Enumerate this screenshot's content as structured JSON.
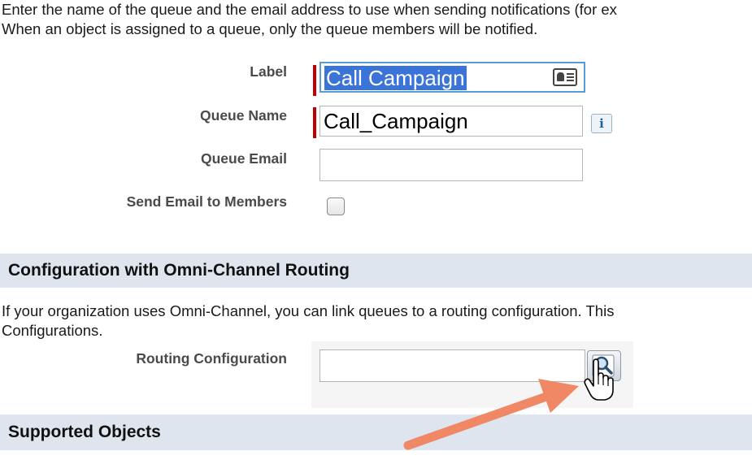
{
  "intro": {
    "line1": "Enter the name of the queue and the email address to use when sending notifications (for ex",
    "line2": "When an object is assigned to a queue, only the queue members will be notified."
  },
  "fields": {
    "label": {
      "label": "Label",
      "value": "Call Campaign",
      "selected": true
    },
    "queue_name": {
      "label": "Queue Name",
      "value": "Call_Campaign"
    },
    "queue_email": {
      "label": "Queue Email",
      "value": ""
    },
    "send_email": {
      "label": "Send Email to Members",
      "checked": false
    }
  },
  "omni_section": {
    "title": "Configuration with Omni-Channel Routing",
    "desc_line1": "If your organization uses Omni-Channel, you can link queues to a routing configuration. This",
    "desc_line2": "Configurations.",
    "routing_label": "Routing Configuration",
    "routing_value": ""
  },
  "supported_section": {
    "title": "Supported Objects"
  },
  "icons": {
    "label_field": "contact-card-icon",
    "queue_name_help": "info-icon",
    "lookup": "magnifier-lookup-icon",
    "cursor": "hand-pointer-icon",
    "annotation": "arrow-icon"
  },
  "colors": {
    "required_bar": "#c00000",
    "section_bar": "#dfe5ee",
    "selection": "#3b74d9",
    "focus_border": "#5b9bd5",
    "annotation_arrow": "#f08866"
  }
}
